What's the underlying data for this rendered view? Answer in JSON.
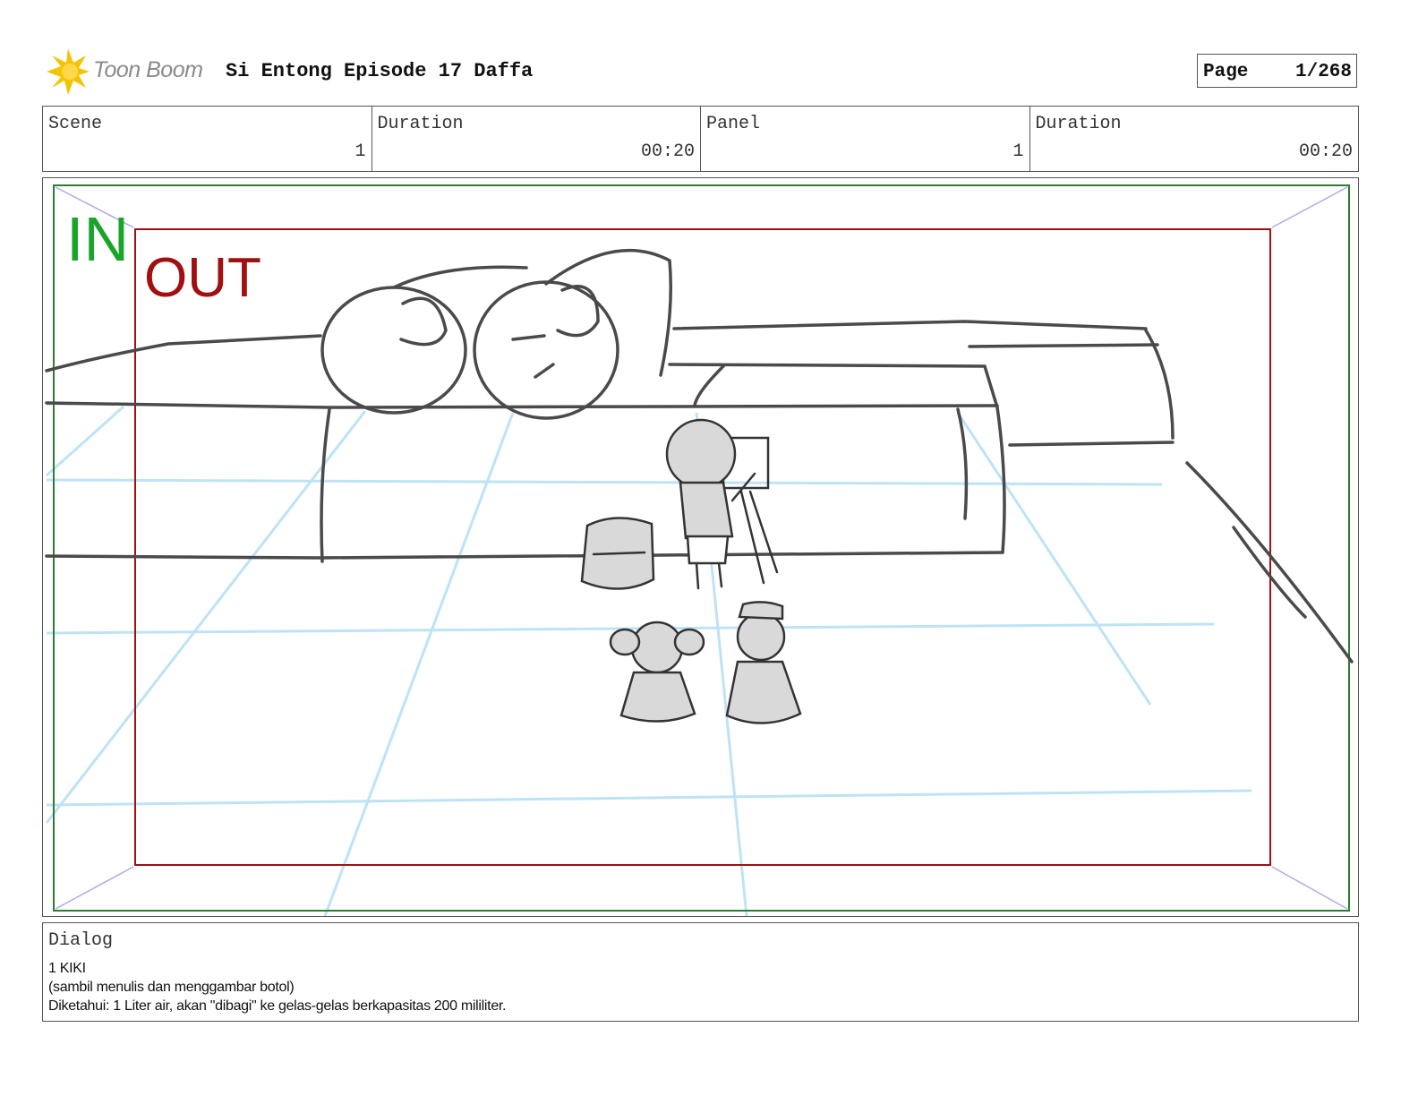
{
  "header": {
    "logo_text": "Toon Boom",
    "title": "Si Entong Episode 17 Daffa",
    "page_label": "Page",
    "page_value": "1/268"
  },
  "info": {
    "scene_label": "Scene",
    "scene_value": "1",
    "scene_duration_label": "Duration",
    "scene_duration_value": "00:20",
    "panel_label": "Panel",
    "panel_value": "1",
    "panel_duration_label": "Duration",
    "panel_duration_value": "00:20"
  },
  "panel": {
    "in_label": "IN",
    "out_label": "OUT",
    "colors": {
      "in_frame": "#2e7d32",
      "in_text": "#1aa52a",
      "out_frame": "#a01010",
      "out_text": "#a01010",
      "guide": "#bde3f5",
      "sketch": "#4a4a4a",
      "corner_arrows": "#b0a8e8"
    }
  },
  "dialog": {
    "label": "Dialog",
    "lines": [
      "1 KIKI",
      "(sambil menulis dan menggambar botol)",
      "Diketahui: 1 Liter air, akan \"dibagi\" ke gelas-gelas berkapasitas 200 mililiter."
    ]
  }
}
